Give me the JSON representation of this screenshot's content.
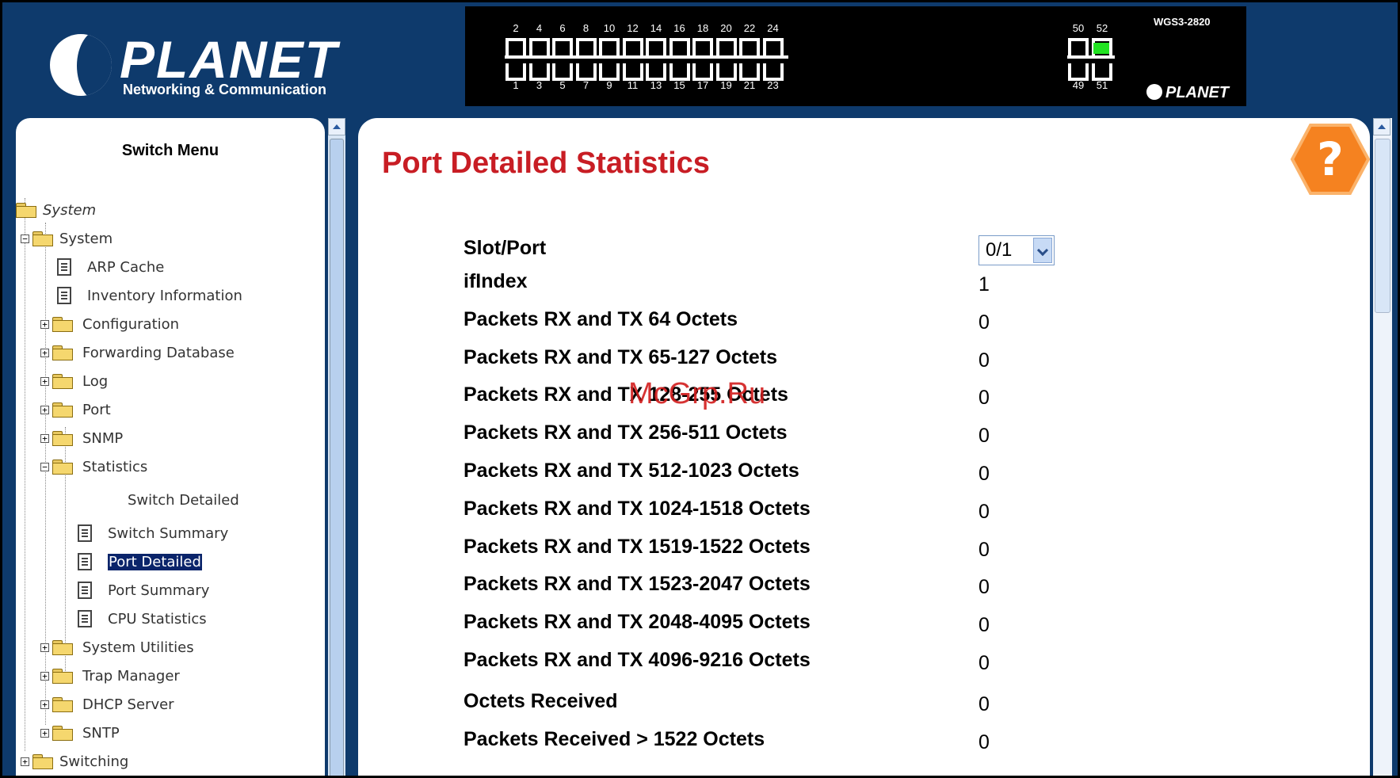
{
  "header": {
    "brand": "PLANET",
    "tagline": "Networking & Communication",
    "panel_model": "WGS3-2820",
    "panel_brand": "PLANET",
    "top_ports": [
      "2",
      "4",
      "6",
      "8",
      "10",
      "12",
      "14",
      "16",
      "18",
      "20",
      "22",
      "24"
    ],
    "bottom_ports": [
      "1",
      "3",
      "5",
      "7",
      "9",
      "11",
      "13",
      "15",
      "17",
      "19",
      "21",
      "23"
    ],
    "sfp_top": [
      "50",
      "52"
    ],
    "sfp_bottom": [
      "49",
      "51"
    ]
  },
  "sidebar": {
    "title": "Switch Menu",
    "items": [
      {
        "label": "System"
      },
      {
        "label": "System"
      },
      {
        "label": "ARP Cache"
      },
      {
        "label": "Inventory Information"
      },
      {
        "label": "Configuration"
      },
      {
        "label": "Forwarding Database"
      },
      {
        "label": "Log"
      },
      {
        "label": "Port"
      },
      {
        "label": "SNMP"
      },
      {
        "label": "Statistics"
      },
      {
        "label": "Switch Detailed"
      },
      {
        "label": "Switch Summary"
      },
      {
        "label": "Port Detailed"
      },
      {
        "label": "Port Summary"
      },
      {
        "label": "CPU Statistics"
      },
      {
        "label": "System Utilities"
      },
      {
        "label": "Trap Manager"
      },
      {
        "label": "DHCP Server"
      },
      {
        "label": "SNTP"
      },
      {
        "label": "Switching"
      }
    ]
  },
  "main": {
    "title": "Port Detailed Statistics",
    "help_glyph": "?",
    "slot_port": {
      "label": "Slot/Port",
      "value": "0/1"
    },
    "rows": [
      {
        "label": "ifIndex",
        "value": "1"
      },
      {
        "label": "Packets RX and TX 64 Octets",
        "value": "0"
      },
      {
        "label": "Packets RX and TX 65-127 Octets",
        "value": "0"
      },
      {
        "label": "Packets RX and TX 128-255 Octets",
        "value": "0"
      },
      {
        "label": "Packets RX and TX 256-511 Octets",
        "value": "0"
      },
      {
        "label": "Packets RX and TX 512-1023 Octets",
        "value": "0"
      },
      {
        "label": "Packets RX and TX 1024-1518 Octets",
        "value": "0"
      },
      {
        "label": "Packets RX and TX 1519-1522 Octets",
        "value": "0"
      },
      {
        "label": "Packets RX and TX 1523-2047 Octets",
        "value": "0"
      },
      {
        "label": "Packets RX and TX 2048-4095 Octets",
        "value": "0"
      },
      {
        "label": "Packets RX and TX 4096-9216 Octets",
        "value": "0"
      },
      {
        "label": "Octets Received",
        "value": "0"
      },
      {
        "label": "Packets Received > 1522 Octets",
        "value": "0"
      }
    ]
  },
  "watermark": "McGrp.Ru"
}
